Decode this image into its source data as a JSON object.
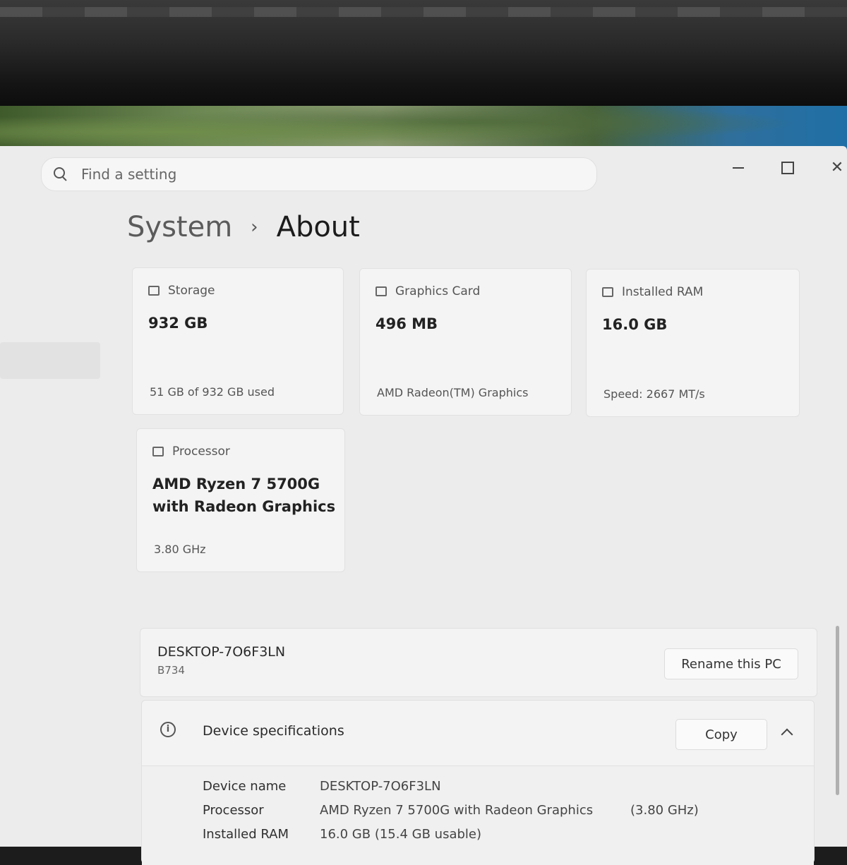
{
  "search": {
    "placeholder": "Find a setting"
  },
  "breadcrumb": {
    "parent": "System",
    "separator": "›",
    "current": "About"
  },
  "cards": {
    "storage": {
      "label": "Storage",
      "value": "932 GB",
      "sub": "51 GB of 932 GB used",
      "icon": "hard-drive-icon"
    },
    "graphics": {
      "label": "Graphics Card",
      "value": "496 MB",
      "sub": "AMD Radeon(TM) Graphics",
      "icon": "graphics-card-icon"
    },
    "ram": {
      "label": "Installed RAM",
      "value": "16.0 GB",
      "sub": "Speed: 2667 MT/s",
      "icon": "memory-icon"
    },
    "processor": {
      "label": "Processor",
      "value": "AMD Ryzen 7 5700G with Radeon Graphics",
      "sub": "3.80 GHz",
      "icon": "processor-icon"
    }
  },
  "pc": {
    "name": "DESKTOP-7O6F3LN",
    "model": "B734",
    "rename_label": "Rename this PC"
  },
  "specs": {
    "title": "Device specifications",
    "copy_label": "Copy",
    "info_glyph": "i",
    "rows": [
      {
        "key": "Device name",
        "value": "DESKTOP-7O6F3LN",
        "extra": ""
      },
      {
        "key": "Processor",
        "value": "AMD Ryzen 7 5700G with Radeon Graphics",
        "extra": "(3.80 GHz)"
      },
      {
        "key": "Installed RAM",
        "value": "16.0 GB (15.4 GB usable)",
        "extra": ""
      }
    ]
  }
}
